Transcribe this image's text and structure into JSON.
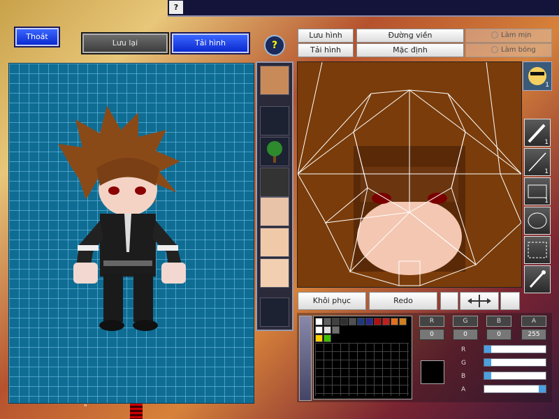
{
  "topbar": {
    "help_glyph": "?"
  },
  "buttons": {
    "exit": "Thoát",
    "save": "Lưu lại",
    "upload": "Tải hình",
    "help": "?"
  },
  "editor_tabs": {
    "save_image": "Lưu hình",
    "outline": "Đường viền",
    "load_image": "Tải hình",
    "default": "Mặc định",
    "smooth": "Làm mịn",
    "shading": "Làm bóng"
  },
  "actions": {
    "restore": "Khôi phục",
    "redo": "Redo"
  },
  "tools": [
    {
      "name": "brush-tool",
      "count": "1"
    },
    {
      "name": "line-tool",
      "count": "1"
    },
    {
      "name": "rectangle-tool",
      "count": "1"
    },
    {
      "name": "ellipse-tool",
      "count": ""
    },
    {
      "name": "select-tool",
      "count": ""
    },
    {
      "name": "eyedropper-tool",
      "count": ""
    }
  ],
  "avatar_count": "1",
  "color_channels": [
    {
      "label": "R",
      "value": "0"
    },
    {
      "label": "G",
      "value": "0"
    },
    {
      "label": "B",
      "value": "0"
    },
    {
      "label": "A",
      "value": "255"
    }
  ],
  "palette_colors": [
    "#ffffff",
    "#606060",
    "#404040",
    "#303030",
    "#505050",
    "#1e3a7a",
    "#2a2a8a",
    "#b01010",
    "#c02020",
    "#e07020",
    "#d08020",
    "#ffffff",
    "#e0e0e0",
    "#707070",
    "#ffd000",
    "#40c000"
  ],
  "footer_mark": "\""
}
